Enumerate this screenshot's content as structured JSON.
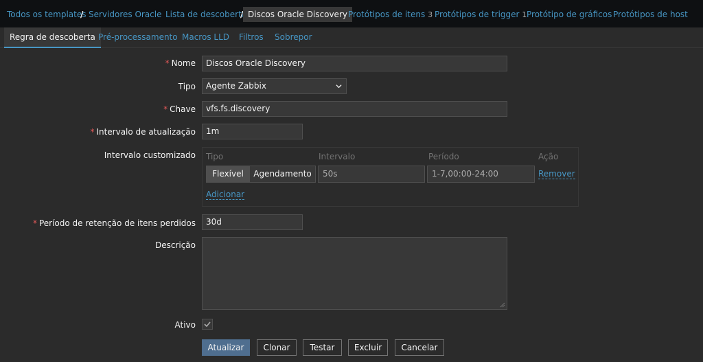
{
  "breadcrumbs": {
    "all_templates": "Todos os templates",
    "template": "Servidores Oracle",
    "discovery_list": "Lista de descoberta",
    "current": "Discos Oracle Discovery",
    "item_prototypes": "Protótipos de itens",
    "item_prototypes_count": "3",
    "trigger_prototypes": "Protótipos de trigger",
    "trigger_prototypes_count": "1",
    "graph_prototypes": "Protótipo de gráficos",
    "host_prototypes": "Protótipos de host"
  },
  "tabs": [
    "Regra de descoberta",
    "Pré-processamento",
    "Macros LLD",
    "Filtros",
    "Sobrepor"
  ],
  "form": {
    "name_label": "Nome",
    "name_value": "Discos Oracle Discovery",
    "type_label": "Tipo",
    "type_value": "Agente Zabbix",
    "key_label": "Chave",
    "key_value": "vfs.fs.discovery",
    "interval_label": "Intervalo de atualização",
    "interval_value": "1m",
    "custom_interval_label": "Intervalo customizado",
    "custom_interval": {
      "col_type": "Tipo",
      "col_interval": "Intervalo",
      "col_period": "Período",
      "col_action": "Ação",
      "flex_label": "Flexível",
      "schedule_label": "Agendamento",
      "interval_value": "50s",
      "period_value": "1-7,00:00-24:00",
      "remove_label": "Remover",
      "add_label": "Adicionar"
    },
    "lost_period_label": "Período de retenção de itens perdidos",
    "lost_period_value": "30d",
    "description_label": "Descrição",
    "description_value": "",
    "active_label": "Ativo",
    "active_checked": true
  },
  "buttons": {
    "update": "Atualizar",
    "clone": "Clonar",
    "test": "Testar",
    "delete": "Excluir",
    "cancel": "Cancelar"
  },
  "colors": {
    "accent": "#4796c4",
    "required": "#e45959",
    "primary_button": "#4f6e8f"
  },
  "icons": {
    "select": "chevron-down-icon",
    "checkbox": "check-icon",
    "textarea": "resize-grip-icon"
  }
}
